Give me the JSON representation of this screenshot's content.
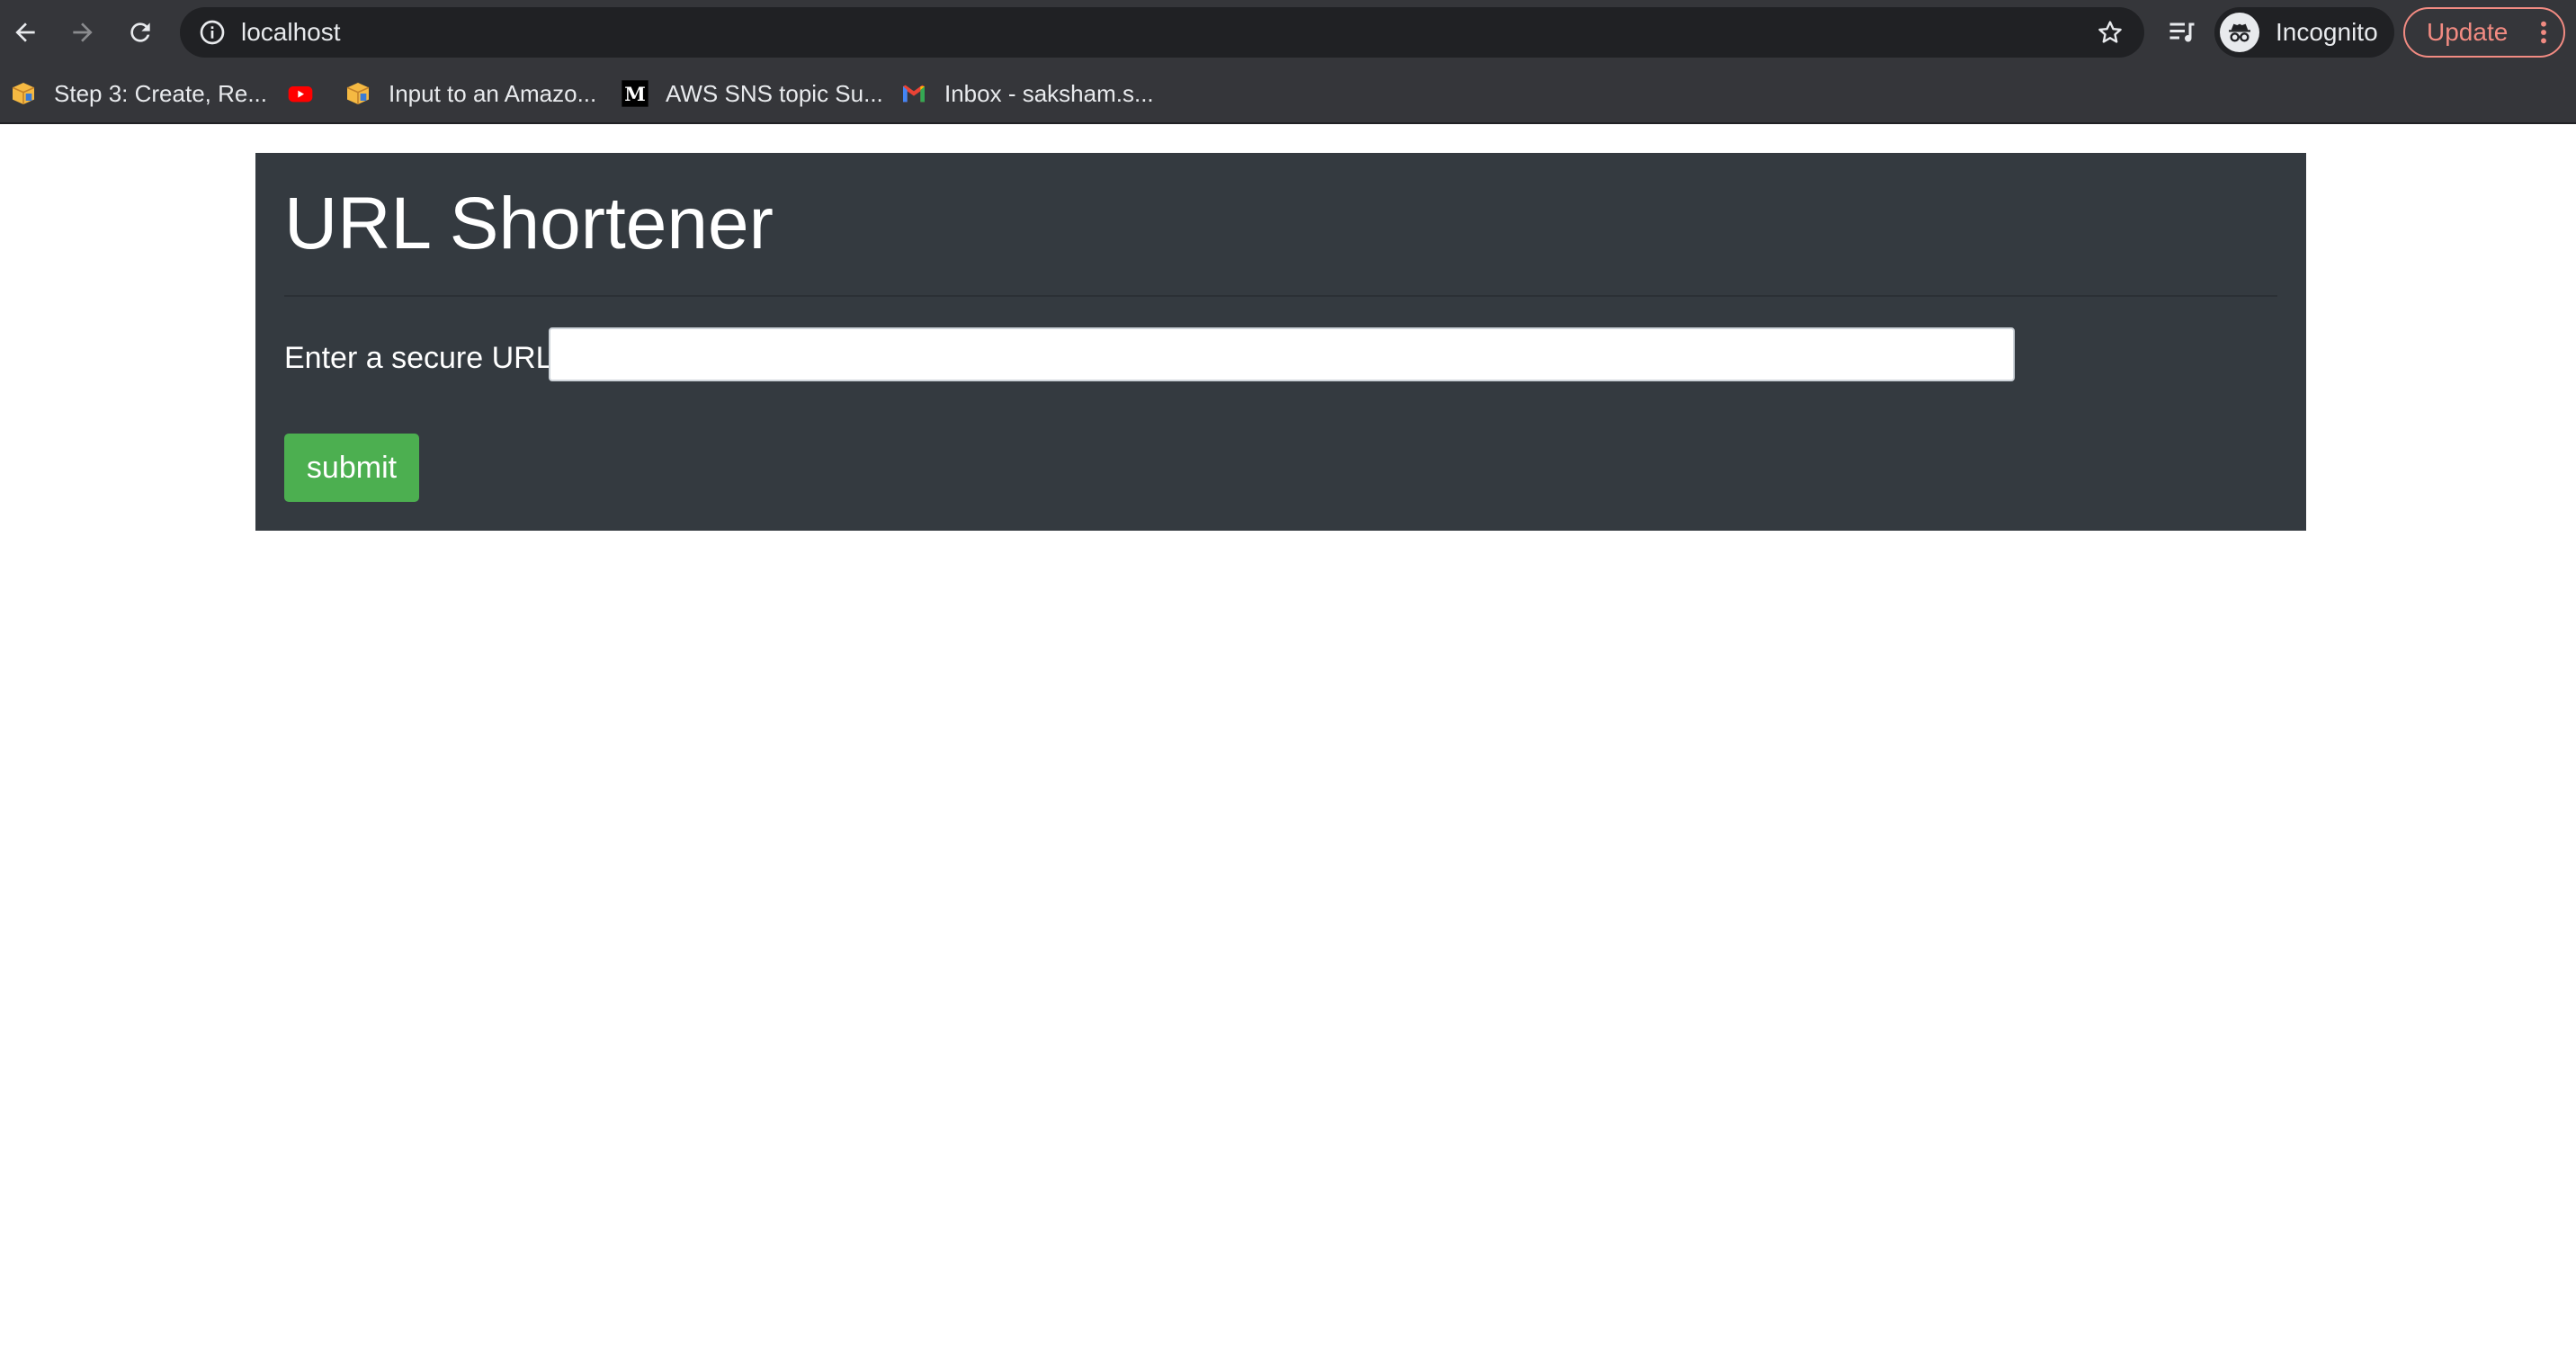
{
  "browser": {
    "address_bar": {
      "url": "localhost"
    },
    "profile": {
      "label": "Incognito"
    },
    "update_button": {
      "label": "Update"
    },
    "bookmarks": [
      {
        "label": "Step 3: Create, Re...",
        "icon": "aws-box-icon"
      },
      {
        "label": "",
        "icon": "youtube-icon"
      },
      {
        "label": "Input to an Amazo...",
        "icon": "aws-box-icon"
      },
      {
        "label": "AWS SNS topic Su...",
        "icon": "medium-icon"
      },
      {
        "label": "Inbox - saksham.s...",
        "icon": "gmail-icon"
      }
    ]
  },
  "page": {
    "title": "URL Shortener",
    "form": {
      "url_label": "Enter a secure URL:",
      "url_value": "",
      "submit_label": "submit"
    },
    "colors": {
      "panel_background": "#343a40",
      "submit_button": "#4caf50"
    }
  }
}
